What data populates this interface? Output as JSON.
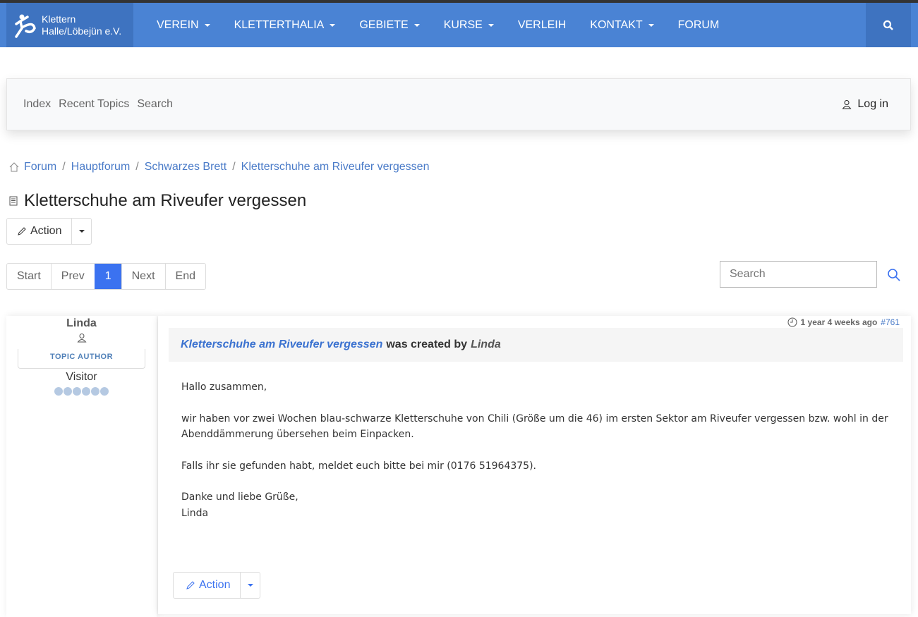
{
  "header": {
    "logo_line1": "Klettern",
    "logo_line2": "Halle/Löbejün e.V.",
    "nav": [
      {
        "label": "VEREIN",
        "dropdown": true
      },
      {
        "label": "KLETTERTHALIA",
        "dropdown": true
      },
      {
        "label": "GEBIETE",
        "dropdown": true
      },
      {
        "label": "KURSE",
        "dropdown": true
      },
      {
        "label": "VERLEIH",
        "dropdown": false
      },
      {
        "label": "KONTAKT",
        "dropdown": true
      },
      {
        "label": "FORUM",
        "dropdown": false
      }
    ]
  },
  "forum_menu": {
    "items": [
      "Index",
      "Recent Topics",
      "Search"
    ],
    "login": "Log in"
  },
  "breadcrumb": [
    "Forum",
    "Hauptforum",
    "Schwarzes Brett",
    "Kletterschuhe am Riveufer vergessen"
  ],
  "title": "Kletterschuhe am Riveufer vergessen",
  "action_label": "Action",
  "pagination": {
    "items": [
      "Start",
      "Prev",
      "1",
      "Next",
      "End"
    ],
    "active": "1"
  },
  "search": {
    "placeholder": "Search"
  },
  "post": {
    "author": "Linda",
    "author_badge": "TOPIC AUTHOR",
    "role": "Visitor",
    "rank_dots": 6,
    "time": "1 year 4 weeks ago",
    "id": "#761",
    "subject": "Kletterschuhe am Riveufer vergessen",
    "created_by": "was created by",
    "user": "Linda",
    "body": [
      "Hallo zusammen,",
      "wir haben vor zwei Wochen blau-schwarze Kletterschuhe von Chili (Größe um die 46) im ersten Sektor am Riveufer vergessen bzw. wohl in der Abenddämmerung übersehen beim Einpacken.",
      "Falls ihr sie gefunden habt, meldet euch bitte bei mir (0176 51964375)."
    ],
    "closing1": "Danke und liebe Grüße,",
    "closing2": "Linda",
    "action_label": "Action"
  }
}
